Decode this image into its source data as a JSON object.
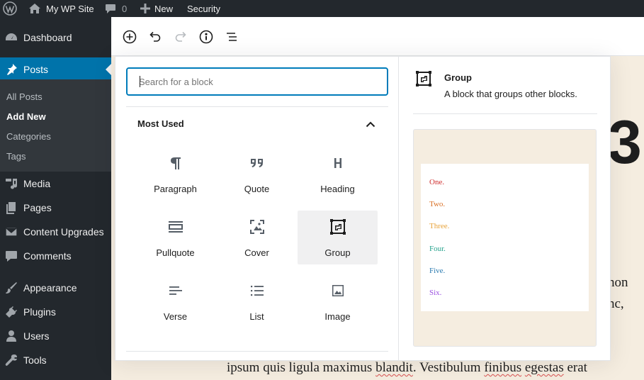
{
  "adminbar": {
    "site_name": "My WP Site",
    "comments_count": "0",
    "new_label": "New",
    "security_label": "Security"
  },
  "sidebar": {
    "items": [
      {
        "label": "Dashboard",
        "icon": "dashboard-icon"
      },
      {
        "label": "Posts",
        "icon": "pin-icon",
        "current": true
      },
      {
        "label": "Media",
        "icon": "media-icon"
      },
      {
        "label": "Pages",
        "icon": "pages-icon"
      },
      {
        "label": "Content Upgrades",
        "icon": "envelope-icon"
      },
      {
        "label": "Comments",
        "icon": "comment-icon"
      },
      {
        "label": "Appearance",
        "icon": "brush-icon"
      },
      {
        "label": "Plugins",
        "icon": "plug-icon"
      },
      {
        "label": "Users",
        "icon": "user-icon"
      },
      {
        "label": "Tools",
        "icon": "wrench-icon"
      }
    ],
    "submenu": [
      {
        "label": "All Posts"
      },
      {
        "label": "Add New",
        "current": true
      },
      {
        "label": "Categories"
      },
      {
        "label": "Tags"
      }
    ]
  },
  "toolbar": {
    "buttons": [
      "add-block",
      "undo",
      "redo",
      "info",
      "outline"
    ]
  },
  "inserter": {
    "search_placeholder": "Search for a block",
    "panel_title": "Most Used",
    "blocks": [
      {
        "label": "Paragraph",
        "icon": "paragraph-icon"
      },
      {
        "label": "Quote",
        "icon": "quote-icon"
      },
      {
        "label": "Heading",
        "icon": "heading-icon"
      },
      {
        "label": "Pullquote",
        "icon": "pullquote-icon"
      },
      {
        "label": "Cover",
        "icon": "cover-icon"
      },
      {
        "label": "Group",
        "icon": "group-icon",
        "hovered": true
      },
      {
        "label": "Verse",
        "icon": "verse-icon"
      },
      {
        "label": "List",
        "icon": "list-icon"
      },
      {
        "label": "Image",
        "icon": "image-icon"
      }
    ],
    "preview": {
      "name": "Group",
      "description": "A block that groups other blocks.",
      "items": [
        {
          "text": "One.",
          "color": "#cf2e2e"
        },
        {
          "text": "Two.",
          "color": "#d96f23"
        },
        {
          "text": "Three.",
          "color": "#e8a33a"
        },
        {
          "text": "Four.",
          "color": "#25a28c"
        },
        {
          "text": "Five.",
          "color": "#2a7ab0"
        },
        {
          "text": "Six.",
          "color": "#9b51e0"
        }
      ]
    }
  },
  "background": {
    "heading_fragment": "3",
    "line1_fragment": "non",
    "line2_fragment": "nc,",
    "line3_text": "ipsum quis ligula maximus blandit. Vestibulum finibus egestas erat",
    "misspelled": [
      "blandit",
      "finibus",
      "egestas"
    ]
  },
  "colors": {
    "admin_dark": "#23282d",
    "admin_submenu": "#32373c",
    "admin_accent": "#0073aa",
    "focus_blue": "#007cba",
    "editor_bg": "#f5ede0"
  }
}
